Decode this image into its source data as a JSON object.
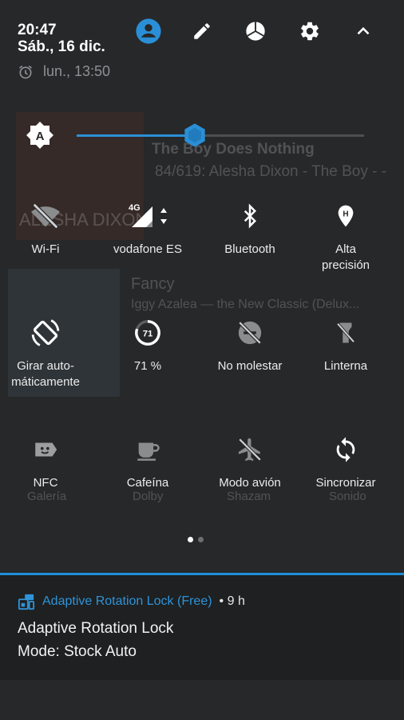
{
  "status": {
    "time": "20:47",
    "date": "Sáb., 16 dic.",
    "alarm": "lun., 13:50"
  },
  "header_icons": [
    "account-icon",
    "edit-icon",
    "data-usage-icon",
    "settings-icon",
    "collapse-icon"
  ],
  "brightness": {
    "level_percent": 41,
    "mode_label": "A"
  },
  "tiles": [
    {
      "label": "Wi-Fi",
      "icon": "wifi-off-icon"
    },
    {
      "label": "vodafone ES",
      "icon": "signal-4g-icon",
      "badge": "4G"
    },
    {
      "label": "Bluetooth",
      "icon": "bluetooth-icon"
    },
    {
      "label": "Alta\nprecisión",
      "icon": "location-icon"
    },
    {
      "label": "Girar auto-\nmáticamente",
      "icon": "auto-rotate-icon"
    },
    {
      "label": "71 %",
      "icon": "battery-icon",
      "badge": "71"
    },
    {
      "label": "No molestar",
      "icon": "do-not-disturb-icon"
    },
    {
      "label": "Linterna",
      "icon": "flashlight-icon"
    },
    {
      "label": "NFC",
      "icon": "nfc-icon"
    },
    {
      "label": "Cafeína",
      "icon": "caffeine-icon"
    },
    {
      "label": "Modo avión",
      "icon": "airplane-icon"
    },
    {
      "label": "Sincronizar",
      "icon": "sync-icon"
    }
  ],
  "pager": {
    "pages": 2,
    "current": 1
  },
  "notification": {
    "app": "Adaptive Rotation Lock (Free)",
    "time": "• 9 h",
    "title": "Adaptive Rotation Lock",
    "text": "Mode: Stock Auto",
    "accent": "#1f8ed6"
  },
  "background_hints": {
    "song": "The Boy Does Nothing",
    "track": "84/619: Alesha Dixon - The Boy - -",
    "artist_art": "ALESHA DIXON",
    "song2": "Fancy",
    "track2": "Iggy Azalea — the New Classic (Delux...",
    "apps": [
      "Galería",
      "Dolby",
      "Shazam",
      "Sonido"
    ]
  },
  "colors": {
    "accent": "#2a8fd6",
    "panel": "#262829"
  }
}
